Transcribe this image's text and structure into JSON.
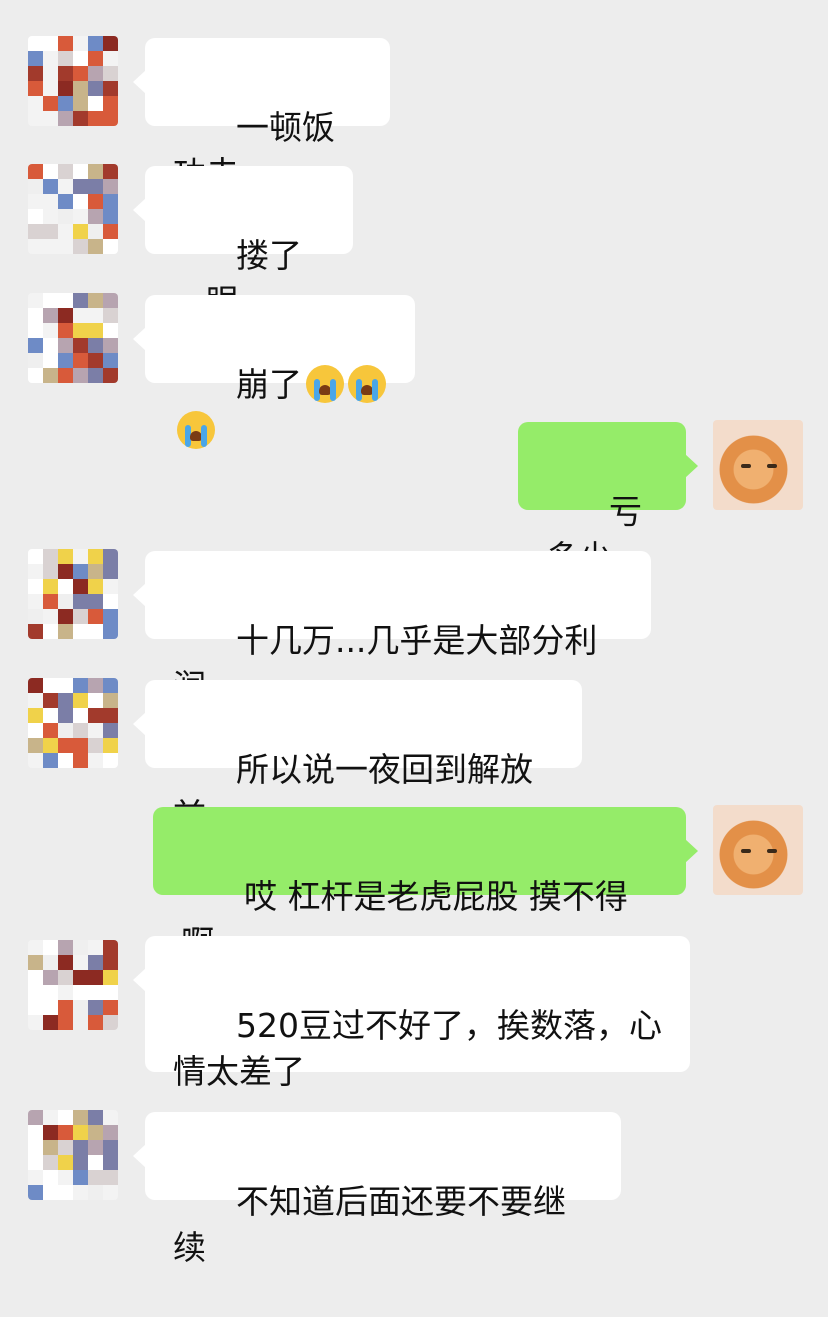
{
  "messages": [
    {
      "side": "left",
      "text": "一顿饭功夫"
    },
    {
      "side": "left",
      "text": "搂了一眼"
    },
    {
      "side": "left",
      "text": "崩了",
      "emoji_count": 3,
      "emoji": "loudly-crying-face"
    },
    {
      "side": "right",
      "text": "亏多少"
    },
    {
      "side": "left",
      "text": "十几万...几乎是大部分利润"
    },
    {
      "side": "left",
      "text": "所以说一夜回到解放前"
    },
    {
      "side": "right",
      "text": "哎 杠杆是老虎屁股 摸不得啊"
    },
    {
      "side": "left",
      "text": "520豆过不好了，挨数落，心\n情太差了"
    },
    {
      "side": "left",
      "text": "不知道后面还要不要继续"
    }
  ],
  "colors": {
    "background": "#ededed",
    "incoming_bubble": "#ffffff",
    "outgoing_bubble": "#95ec69"
  },
  "avatars": {
    "other": "pixelated-avatar",
    "self": "cat-photo-avatar"
  }
}
